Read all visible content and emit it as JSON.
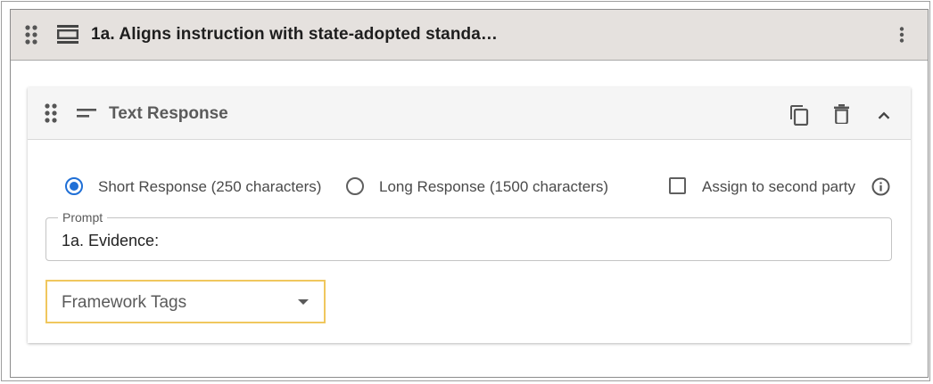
{
  "section": {
    "title": "1a. Aligns instruction with state-adopted standa…",
    "icons": {
      "drag": "drag-handle-icon",
      "type": "section-layout-icon",
      "more": "more-vertical-icon"
    }
  },
  "card": {
    "title": "Text Response",
    "icons": {
      "drag": "drag-handle-icon",
      "type": "short-text-icon",
      "copy": "copy-icon",
      "delete": "trash-icon",
      "collapse": "chevron-up-icon"
    },
    "response_options": [
      {
        "label": "Short Response (250 characters)",
        "checked": true
      },
      {
        "label": "Long Response (1500 characters)",
        "checked": false
      }
    ],
    "second_party": {
      "label": "Assign to second party",
      "checked": false,
      "info_icon": "info-icon"
    },
    "prompt": {
      "label": "Prompt",
      "value": "1a. Evidence:"
    },
    "framework_tags": {
      "placeholder": "Framework Tags",
      "icon": "dropdown-arrow-icon"
    }
  },
  "colors": {
    "header_bg": "#e5e1de",
    "card_header_bg": "#f5f5f5",
    "accent_blue": "#1f6fd6",
    "focus_yellow": "#f0c75e"
  }
}
